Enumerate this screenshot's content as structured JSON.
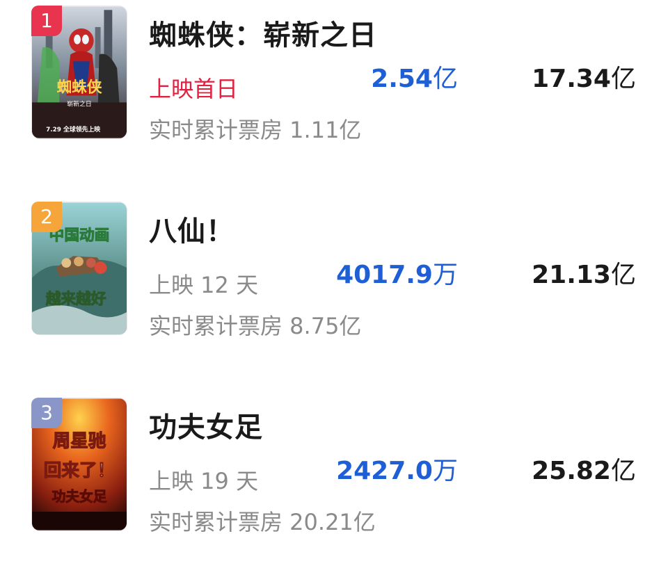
{
  "movies": [
    {
      "rank": "1",
      "rank_color": "#e8344e",
      "title": "蜘蛛侠：崭新之日",
      "status": "上映首日",
      "cumulative": "实时累计票房 1.11亿",
      "today_value": "2.54",
      "today_unit": "亿",
      "total_value": "17.34",
      "total_unit": "亿",
      "poster_text": [
        "蜘蛛侠",
        "崭新之日",
        "7.29 全球领先上映"
      ]
    },
    {
      "rank": "2",
      "rank_color": "#f5a53a",
      "title": "八仙！",
      "status": "上映 12 天",
      "cumulative": "实时累计票房 8.75亿",
      "today_value": "4017.9",
      "today_unit": "万",
      "total_value": "21.13",
      "total_unit": "亿",
      "poster_text": [
        "中国动画",
        "越来越好"
      ]
    },
    {
      "rank": "3",
      "rank_color": "#8a96c8",
      "title": "功夫女足",
      "status": "上映 19 天",
      "cumulative": "实时累计票房 20.21亿",
      "today_value": "2427.0",
      "today_unit": "万",
      "total_value": "25.82",
      "total_unit": "亿",
      "poster_text": [
        "周星驰",
        "回来了！",
        "功夫女足"
      ]
    }
  ]
}
